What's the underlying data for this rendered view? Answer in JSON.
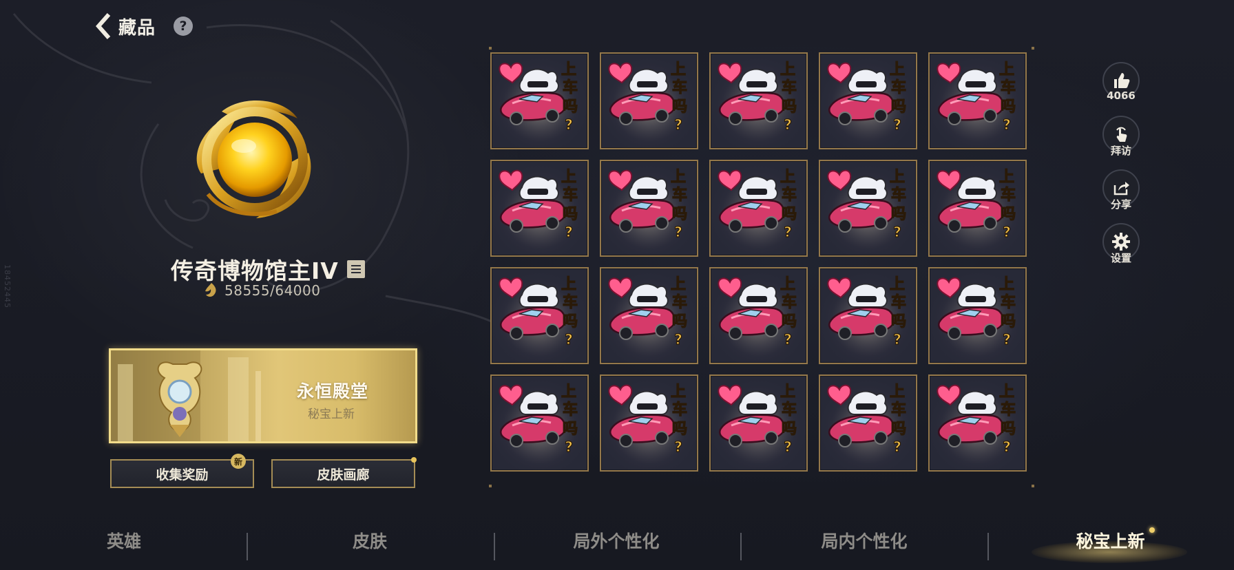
{
  "header": {
    "title": "藏品",
    "help_label": "?"
  },
  "side_tag": "18452445",
  "rank": {
    "name": "传奇博物馆主IV",
    "points": "58555/64000"
  },
  "banner": {
    "title": "永恒殿堂",
    "subtitle": "秘宝上新"
  },
  "actions": {
    "rewards_label": "收集奖励",
    "rewards_badge": "新",
    "gallery_label": "皮肤画廊"
  },
  "grid": {
    "rows": 4,
    "cols": 5,
    "item_text": [
      "上",
      "车",
      "吗",
      "?"
    ]
  },
  "social": {
    "like_count": "4066",
    "visit_label": "拜访",
    "share_label": "分享",
    "settings_label": "设置"
  },
  "nav": {
    "tabs": [
      "英雄",
      "皮肤",
      "局外个性化",
      "局内个性化",
      "秘宝上新"
    ],
    "active_index": 4
  },
  "colors": {
    "gold": "#d6b45c",
    "frame": "#94784a",
    "background": "#191b24",
    "heart": "#ff5e8e",
    "car": "#d63a6a"
  },
  "icons": {
    "back": "chevron-left-icon",
    "help": "question-icon",
    "like": "thumbs-up-icon",
    "visit": "touch-hand-icon",
    "share": "share-icon",
    "settings": "gear-icon",
    "rank_list": "list-icon",
    "points": "museum-points-icon"
  }
}
